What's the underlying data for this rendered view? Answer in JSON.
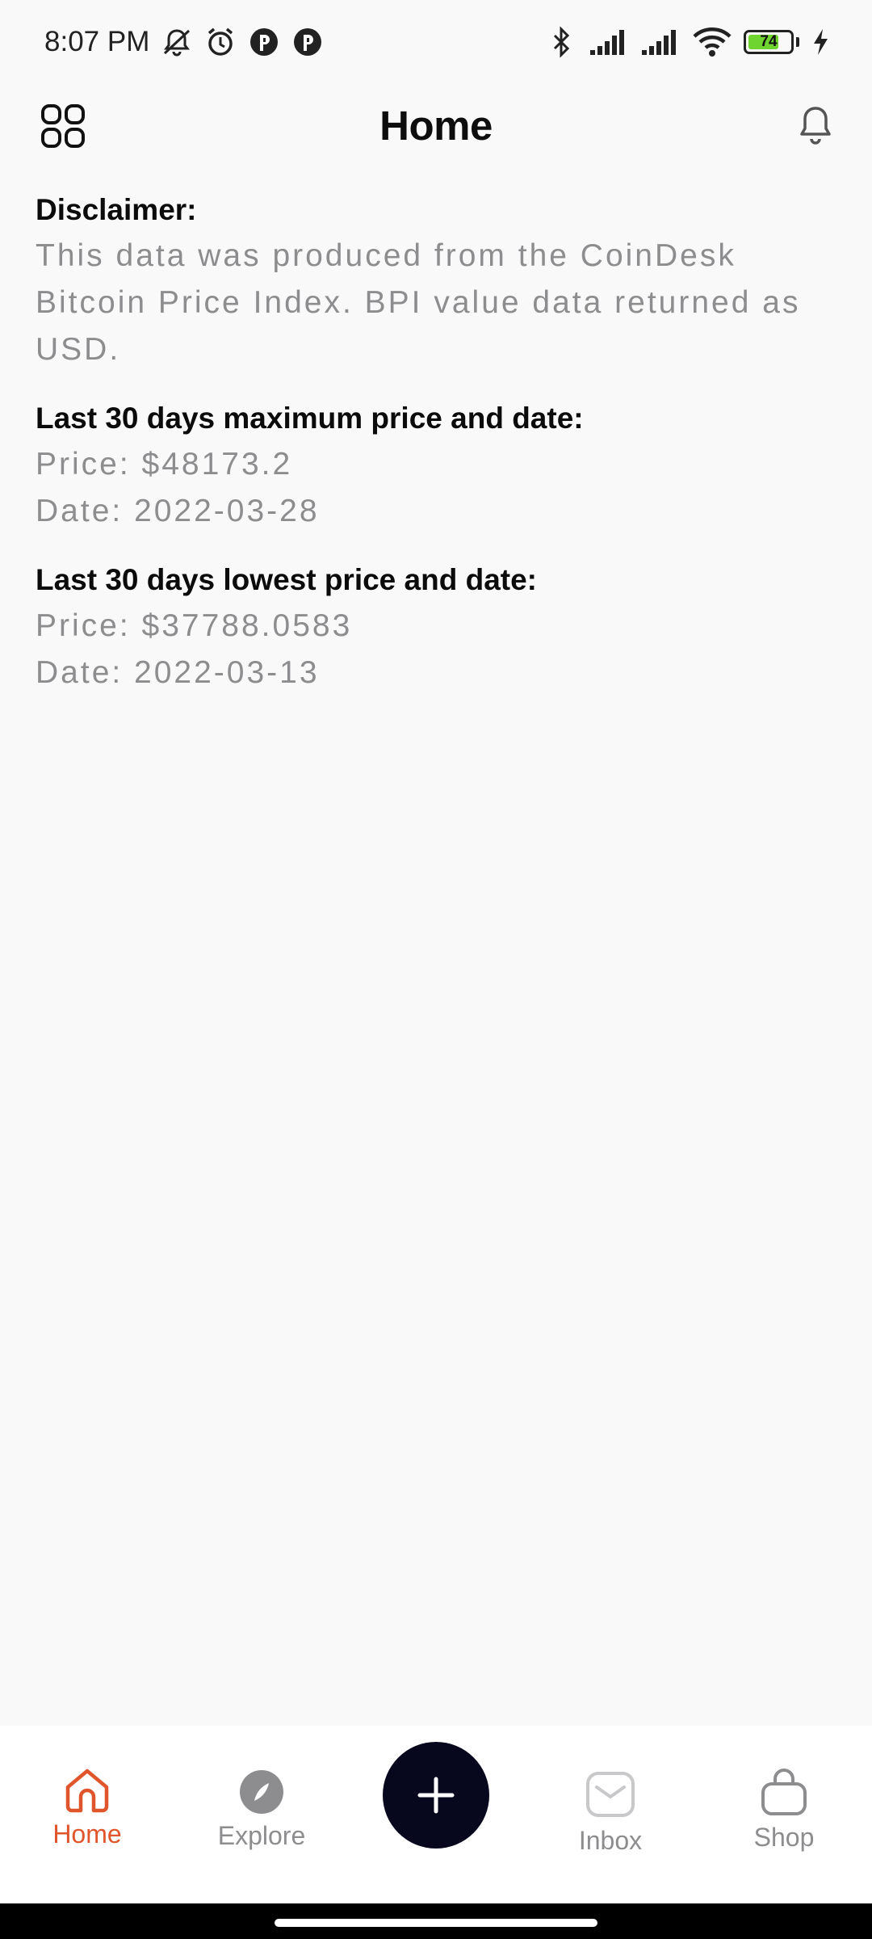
{
  "status_bar": {
    "time": "8:07 PM",
    "battery_level": "74",
    "battery_fraction": 0.74,
    "left_icons": [
      "muted-bell-icon",
      "alarm-icon",
      "app-notification-icon",
      "app-notification-icon"
    ],
    "right_icons": [
      "bluetooth-icon",
      "signal-icon",
      "signal-icon",
      "wifi-icon",
      "battery-icon",
      "charging-icon"
    ]
  },
  "header": {
    "title": "Home",
    "menu_icon": "grid-menu-icon",
    "notification_icon": "bell-icon"
  },
  "disclaimer": {
    "heading": "Disclaimer:",
    "text": "This data was produced from the CoinDesk Bitcoin Price Index. BPI value data returned as USD."
  },
  "max_section": {
    "heading": "Last 30 days maximum price and date:",
    "price": "Price: $48173.2",
    "date": "Date: 2022-03-28"
  },
  "min_section": {
    "heading": "Last 30 days lowest price and date:",
    "price": "Price: $37788.0583",
    "date": "Date: 2022-03-13"
  },
  "bottom_nav": {
    "items": [
      {
        "label": "Home",
        "icon": "home-icon",
        "active": true
      },
      {
        "label": "Explore",
        "icon": "compass-icon",
        "active": false
      },
      {
        "label": "Inbox",
        "icon": "mail-icon",
        "active": false
      },
      {
        "label": "Shop",
        "icon": "shopping-bag-icon",
        "active": false
      }
    ],
    "fab_icon": "plus-icon"
  },
  "colors": {
    "accent": "#e0552b",
    "inactive": "#8d8d8f",
    "fab": "#07071d",
    "background": "#f9f9f9"
  }
}
